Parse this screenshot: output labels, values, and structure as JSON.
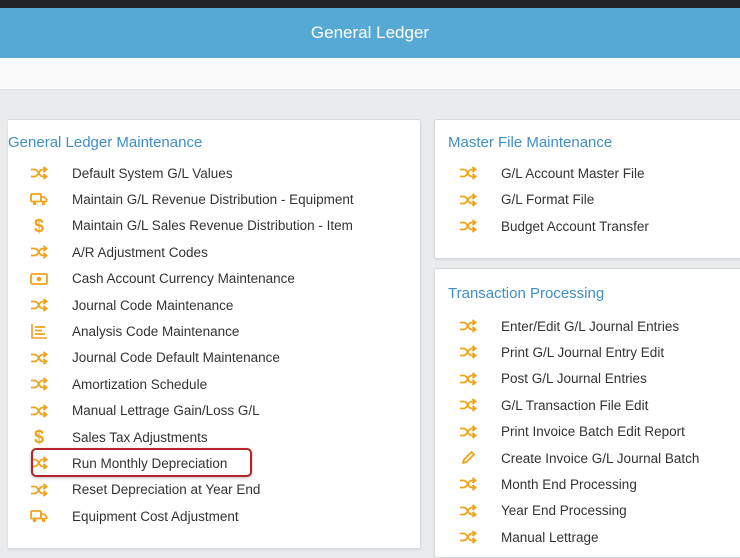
{
  "header": {
    "title": "General Ledger"
  },
  "gl_maintenance": {
    "title": "General Ledger Maintenance",
    "items": [
      {
        "label": "Default System G/L Values",
        "icon": "shuffle-icon"
      },
      {
        "label": "Maintain G/L Revenue Distribution - Equipment",
        "icon": "truck-icon"
      },
      {
        "label": "Maintain G/L Sales Revenue Distribution - Item",
        "icon": "dollar-icon"
      },
      {
        "label": "A/R Adjustment Codes",
        "icon": "shuffle-icon"
      },
      {
        "label": "Cash Account Currency Maintenance",
        "icon": "money-icon"
      },
      {
        "label": "Journal Code Maintenance",
        "icon": "shuffle-icon"
      },
      {
        "label": "Analysis Code Maintenance",
        "icon": "list-icon"
      },
      {
        "label": "Journal Code Default Maintenance",
        "icon": "shuffle-icon"
      },
      {
        "label": "Amortization Schedule",
        "icon": "shuffle-icon"
      },
      {
        "label": "Manual Lettrage Gain/Loss G/L",
        "icon": "shuffle-icon"
      },
      {
        "label": "Sales Tax Adjustments",
        "icon": "dollar-icon"
      },
      {
        "label": "Run Monthly Depreciation",
        "icon": "shuffle-icon"
      },
      {
        "label": "Reset Depreciation at Year End",
        "icon": "shuffle-icon"
      },
      {
        "label": "Equipment Cost Adjustment",
        "icon": "truck-icon"
      }
    ]
  },
  "master_file": {
    "title": "Master File Maintenance",
    "items": [
      {
        "label": "G/L Account Master File",
        "icon": "shuffle-icon"
      },
      {
        "label": "G/L Format File",
        "icon": "shuffle-icon"
      },
      {
        "label": "Budget Account Transfer",
        "icon": "shuffle-icon"
      }
    ]
  },
  "transaction": {
    "title": "Transaction Processing",
    "items": [
      {
        "label": "Enter/Edit G/L Journal Entries",
        "icon": "shuffle-icon"
      },
      {
        "label": "Print G/L Journal Entry Edit",
        "icon": "shuffle-icon"
      },
      {
        "label": "Post G/L Journal Entries",
        "icon": "shuffle-icon"
      },
      {
        "label": "G/L Transaction File Edit",
        "icon": "shuffle-icon"
      },
      {
        "label": "Print Invoice Batch Edit Report",
        "icon": "shuffle-icon"
      },
      {
        "label": "Create Invoice G/L Journal Batch",
        "icon": "pencil-icon"
      },
      {
        "label": "Month End Processing",
        "icon": "shuffle-icon"
      },
      {
        "label": "Year End Processing",
        "icon": "shuffle-icon"
      },
      {
        "label": "Manual Lettrage",
        "icon": "shuffle-icon"
      }
    ]
  },
  "colors": {
    "accent": "#56a9d5",
    "icon": "#f0a21a",
    "title": "#3f8fc4",
    "highlight": "#b8232a"
  }
}
